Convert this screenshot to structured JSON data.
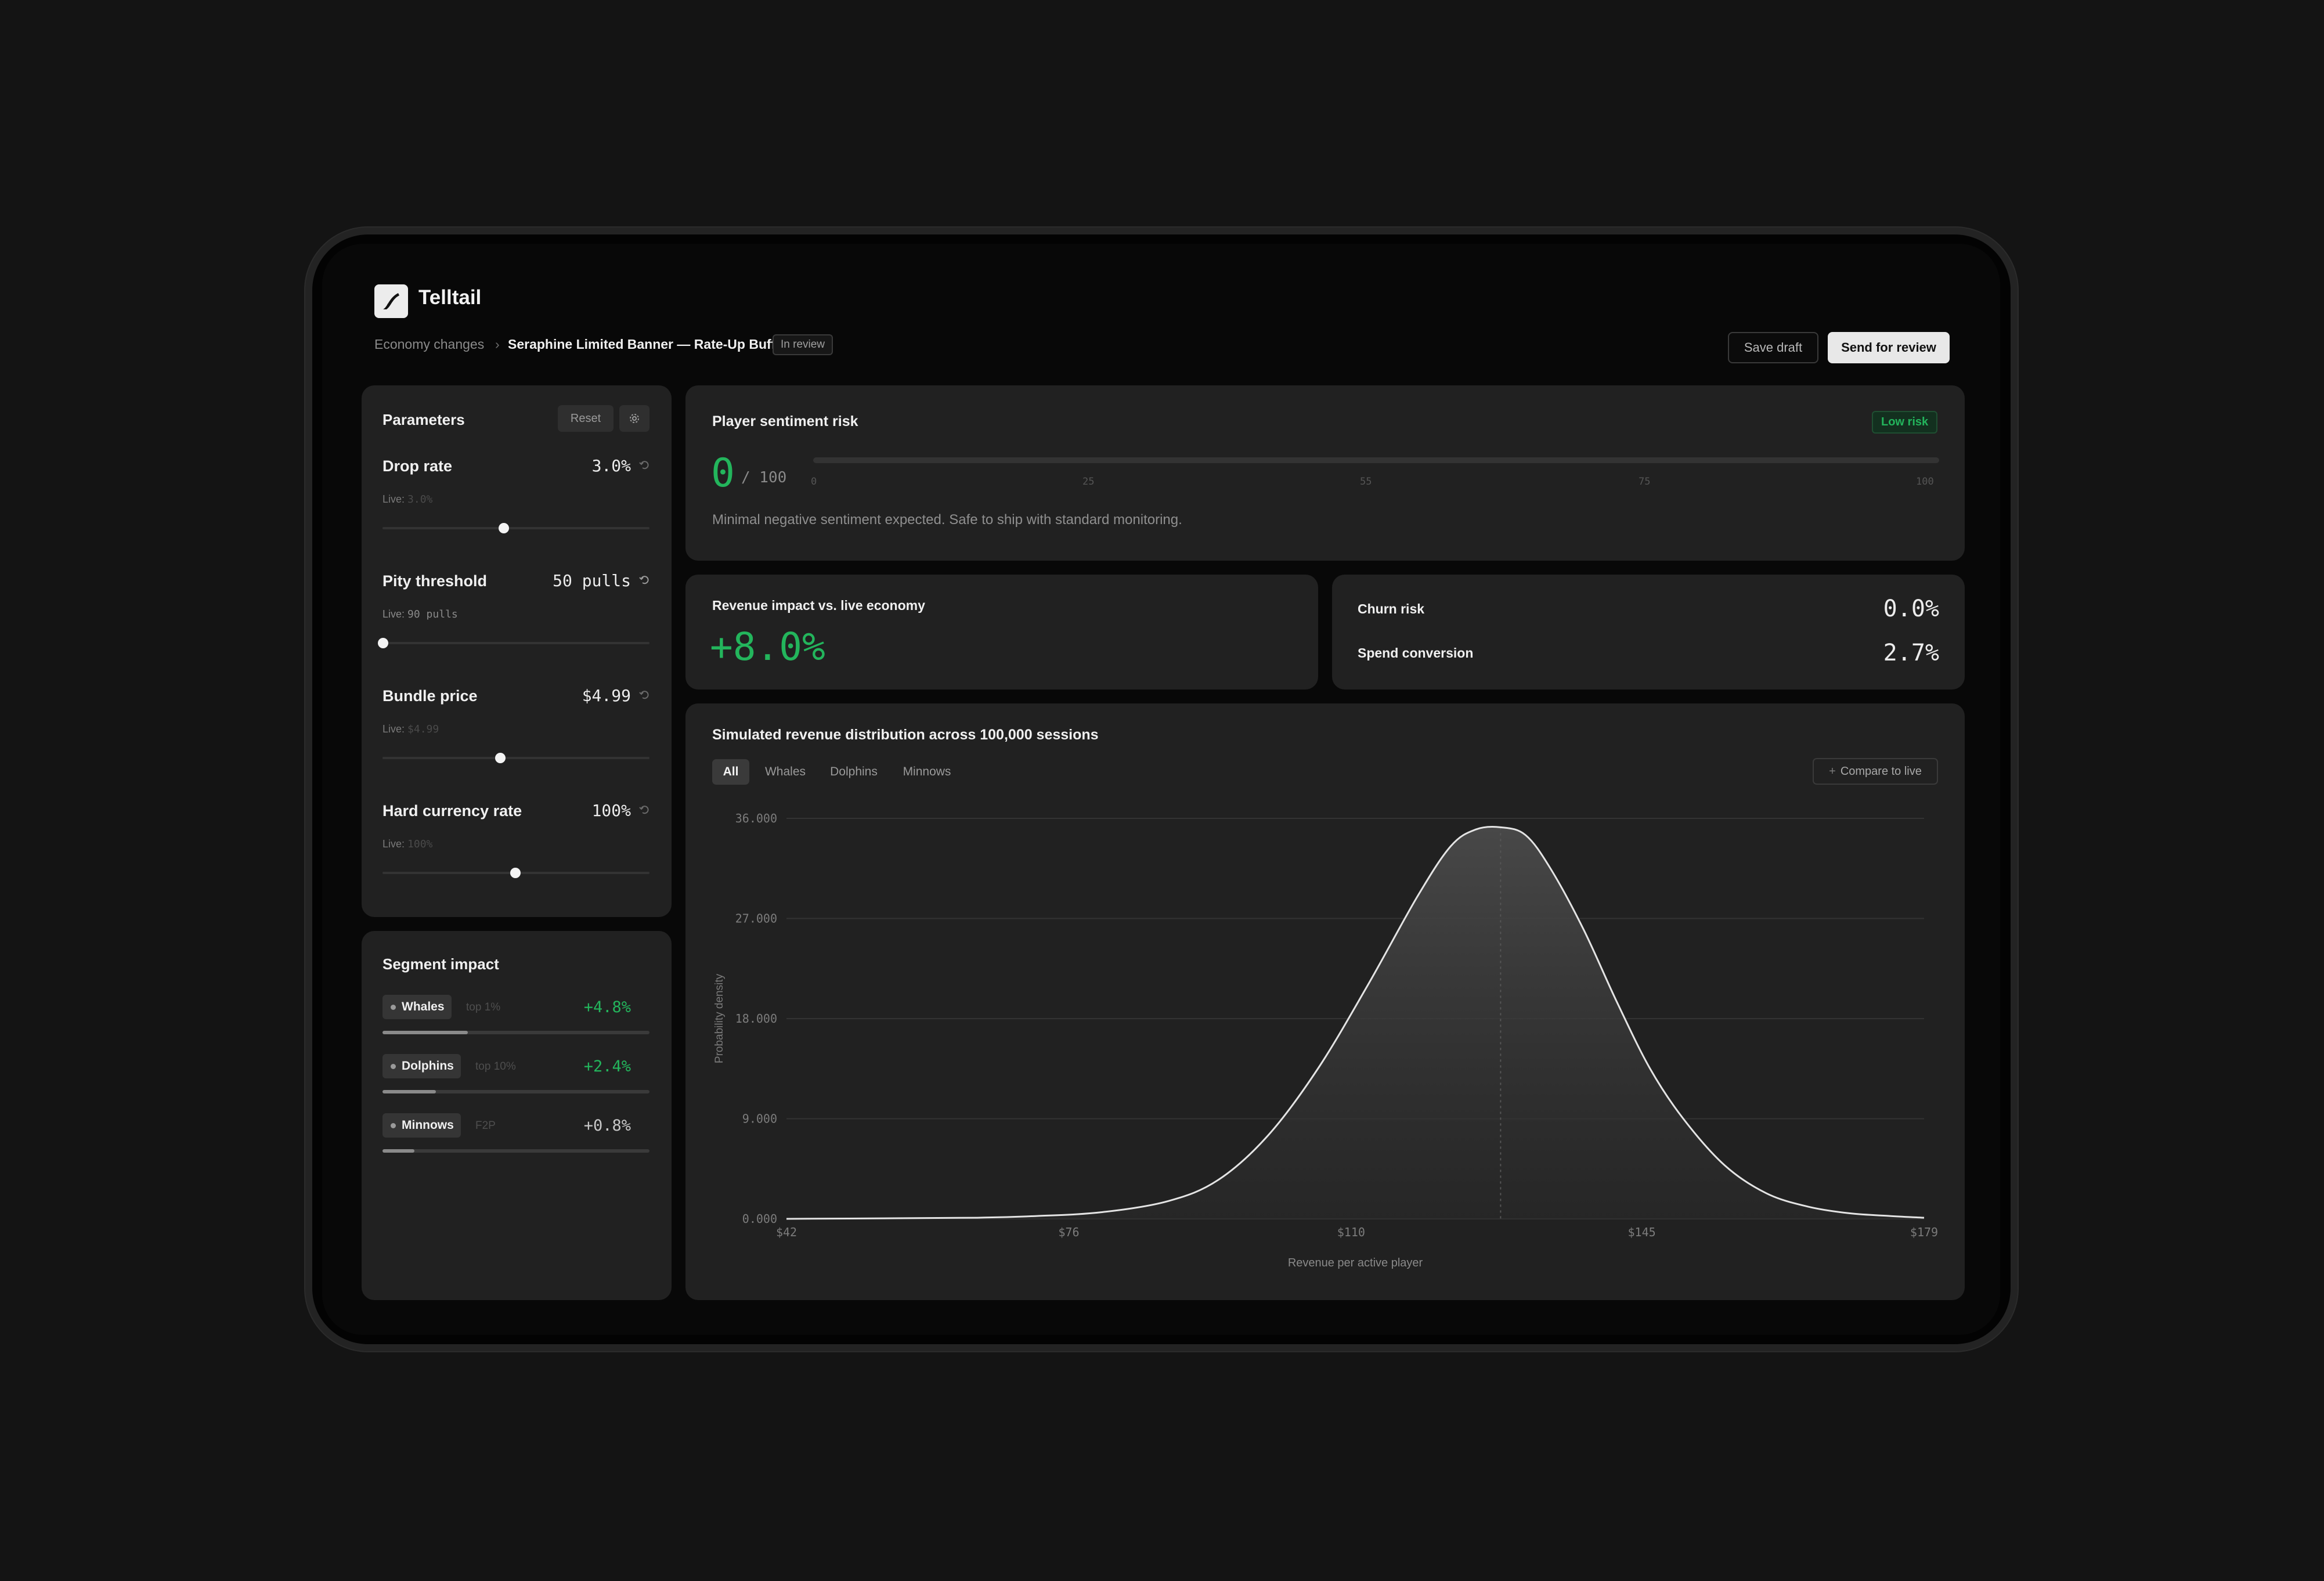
{
  "app": {
    "name": "Telltail"
  },
  "breadcrumb": {
    "parent": "Economy changes",
    "separator": "›",
    "current": "Seraphine Limited Banner — Rate-Up Buff",
    "status": "In review"
  },
  "actions": {
    "save_draft": "Save draft",
    "send_review": "Send for review"
  },
  "parameters": {
    "title": "Parameters",
    "reset": "Reset",
    "items": [
      {
        "name": "Drop rate",
        "value": "3.0%",
        "live_label": "Live:",
        "live_value": "3.0%",
        "slider_fraction": 0.45
      },
      {
        "name": "Pity threshold",
        "value": "50 pulls",
        "live_label": "Live:",
        "live_value": "90 pulls",
        "slider_fraction": 0.0
      },
      {
        "name": "Bundle price",
        "value": "$4.99",
        "live_label": "Live:",
        "live_value": "$4.99",
        "slider_fraction": 0.44
      },
      {
        "name": "Hard currency rate",
        "value": "100%",
        "live_label": "Live:",
        "live_value": "100%",
        "slider_fraction": 0.5
      }
    ]
  },
  "segments": {
    "title": "Segment impact",
    "items": [
      {
        "name": "Whales",
        "note": "top 1%",
        "value": "+4.8%",
        "fill_fraction": 0.32
      },
      {
        "name": "Dolphins",
        "note": "top 10%",
        "value": "+2.4%",
        "fill_fraction": 0.2
      },
      {
        "name": "Minnows",
        "note": "F2P",
        "value": "+0.8%",
        "fill_fraction": 0.12
      }
    ]
  },
  "sentiment": {
    "title": "Player sentiment risk",
    "badge": "Low risk",
    "score": "0",
    "out_of": "/ 100",
    "ticks": [
      "0",
      "25",
      "55",
      "75",
      "100"
    ],
    "description": "Minimal negative sentiment expected. Safe to ship with standard monitoring."
  },
  "revenue_impact": {
    "title": "Revenue impact vs. live economy",
    "value": "+8.0%"
  },
  "metrics": [
    {
      "label": "Churn risk",
      "value": "0.0%"
    },
    {
      "label": "Spend conversion",
      "value": "2.7%"
    }
  ],
  "distribution": {
    "title": "Simulated revenue distribution across 100,000 sessions",
    "tabs": [
      "All",
      "Whales",
      "Dolphins",
      "Minnows"
    ],
    "compare": "Compare to live"
  },
  "chart_data": {
    "type": "area",
    "xlabel": "Revenue per active player",
    "ylabel": "Probability density",
    "x_tick_labels": [
      "$42",
      "$76",
      "$110",
      "$145",
      "$179"
    ],
    "y_tick_labels": [
      "36.000",
      "27.000",
      "18.000",
      "9.000",
      "0.000"
    ],
    "xlim": [
      42,
      179
    ],
    "ylim": [
      0,
      36
    ],
    "series": [
      {
        "x": [
          42,
          55,
          65,
          72,
          80,
          88,
          94,
          100,
          106,
          112,
          118,
          122,
          125,
          128,
          131,
          134,
          138,
          142,
          146,
          150,
          155,
          160,
          165,
          170,
          175,
          179
        ],
        "y": [
          0.0,
          0.05,
          0.1,
          0.25,
          0.6,
          1.6,
          3.5,
          7.5,
          13.5,
          21.0,
          29.0,
          33.5,
          35.0,
          35.2,
          34.5,
          31.5,
          26.0,
          19.5,
          13.5,
          9.0,
          4.8,
          2.3,
          1.1,
          0.5,
          0.25,
          0.1
        ]
      }
    ],
    "grid": true,
    "mean_marker": 128
  },
  "colors": {
    "accent_green": "#23b55c",
    "panel": "#212121",
    "background": "#141414"
  }
}
